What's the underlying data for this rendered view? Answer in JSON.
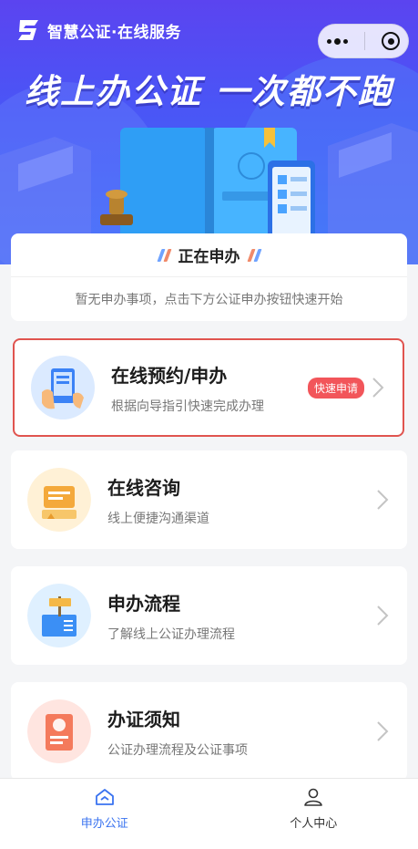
{
  "header": {
    "app_title": "智慧公证·在线服务",
    "slogan": "线上办公证 一次都不跑"
  },
  "status": {
    "title": "正在申办",
    "empty_text": "暂无申办事项，点击下方公证申办按钮快速开始"
  },
  "services": [
    {
      "title": "在线预约/申办",
      "subtitle": "根据向导指引快速完成办理",
      "badge": "快速申请"
    },
    {
      "title": "在线咨询",
      "subtitle": "线上便捷沟通渠道"
    },
    {
      "title": "申办流程",
      "subtitle": "了解线上公证办理流程"
    },
    {
      "title": "办证须知",
      "subtitle": "公证办理流程及公证事项"
    }
  ],
  "tabbar": {
    "tabs": [
      {
        "label": "申办公证",
        "icon": "home-icon",
        "active": true
      },
      {
        "label": "个人中心",
        "icon": "user-icon",
        "active": false
      }
    ]
  },
  "colors": {
    "accent": "#3a73f0",
    "badge": "#f2555a",
    "highlight": "#e0544f"
  }
}
